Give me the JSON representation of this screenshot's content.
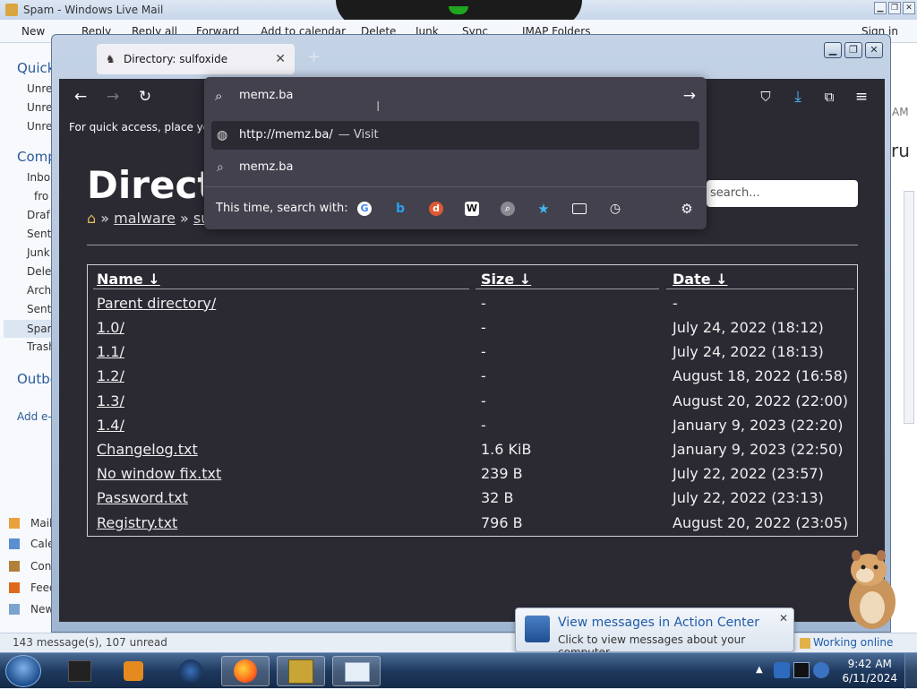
{
  "mail": {
    "title": "Spam - Windows Live Mail",
    "ribbon": [
      "New",
      "Reply",
      "Reply all",
      "Forward",
      "Add to calendar",
      "Delete",
      "Junk",
      "Sync",
      "IMAP Folders"
    ],
    "sign_in": "Sign in",
    "left_items": [
      "Quick",
      "Unre",
      "Unre",
      "Unre",
      "Comp",
      "Inbo",
      "fro",
      "Draf",
      "Sent",
      "Junk",
      "Delet",
      "Archi",
      "Sent",
      "Spam",
      "Trash",
      "Outbo",
      "Add e-",
      "Mail",
      "Cale",
      "Con",
      "Feed",
      "New"
    ],
    "right_fragments": [
      "AM",
      "ru"
    ],
    "status": "143 message(s), 107 unread",
    "working": "Working online"
  },
  "firefox": {
    "tab_title": "Directory: sulfoxide",
    "bookmarks_hint": "For quick access, place your b",
    "urlbar": {
      "value": "memz.ba",
      "suggestions": [
        {
          "text": "http://memz.ba/",
          "action": "— Visit"
        },
        {
          "text": "memz.ba",
          "action": ""
        }
      ],
      "search_with": "This time, search with:",
      "engines": [
        "google-icon",
        "bing-icon",
        "duckduckgo-icon",
        "wikipedia-icon",
        "search-engine-icon",
        "bookmarks-icon",
        "tabs-icon",
        "history-icon"
      ]
    },
    "page": {
      "title": "Directory: sulfoxide",
      "breadcrumb": [
        "malware",
        "sulfoxide"
      ],
      "search_placeholder": "search...",
      "columns": [
        "Name ↓",
        "Size ↓",
        "Date ↓"
      ],
      "rows": [
        {
          "name": "Parent directory/",
          "size": "-",
          "date": "-"
        },
        {
          "name": "1.0/",
          "size": "-",
          "date": "July 24, 2022 (18:12)"
        },
        {
          "name": "1.1/",
          "size": "-",
          "date": "July 24, 2022 (18:13)"
        },
        {
          "name": "1.2/",
          "size": "-",
          "date": "August 18, 2022 (16:58)"
        },
        {
          "name": "1.3/",
          "size": "-",
          "date": "August 20, 2022 (22:00)"
        },
        {
          "name": "1.4/",
          "size": "-",
          "date": "January 9, 2023 (22:20)"
        },
        {
          "name": "Changelog.txt",
          "size": "1.6 KiB",
          "date": "January 9, 2023 (22:50)"
        },
        {
          "name": "No window fix.txt",
          "size": "239 B",
          "date": "July 22, 2022 (23:57)"
        },
        {
          "name": "Password.txt",
          "size": "32 B",
          "date": "July 22, 2022 (23:13)"
        },
        {
          "name": "Registry.txt",
          "size": "796 B",
          "date": "August 20, 2022 (23:05)"
        }
      ]
    }
  },
  "notification": {
    "title": "View messages in Action Center",
    "message": "Click to view messages about your computer."
  },
  "taskbar": {
    "time": "9:42 AM",
    "date": "6/11/2024"
  }
}
